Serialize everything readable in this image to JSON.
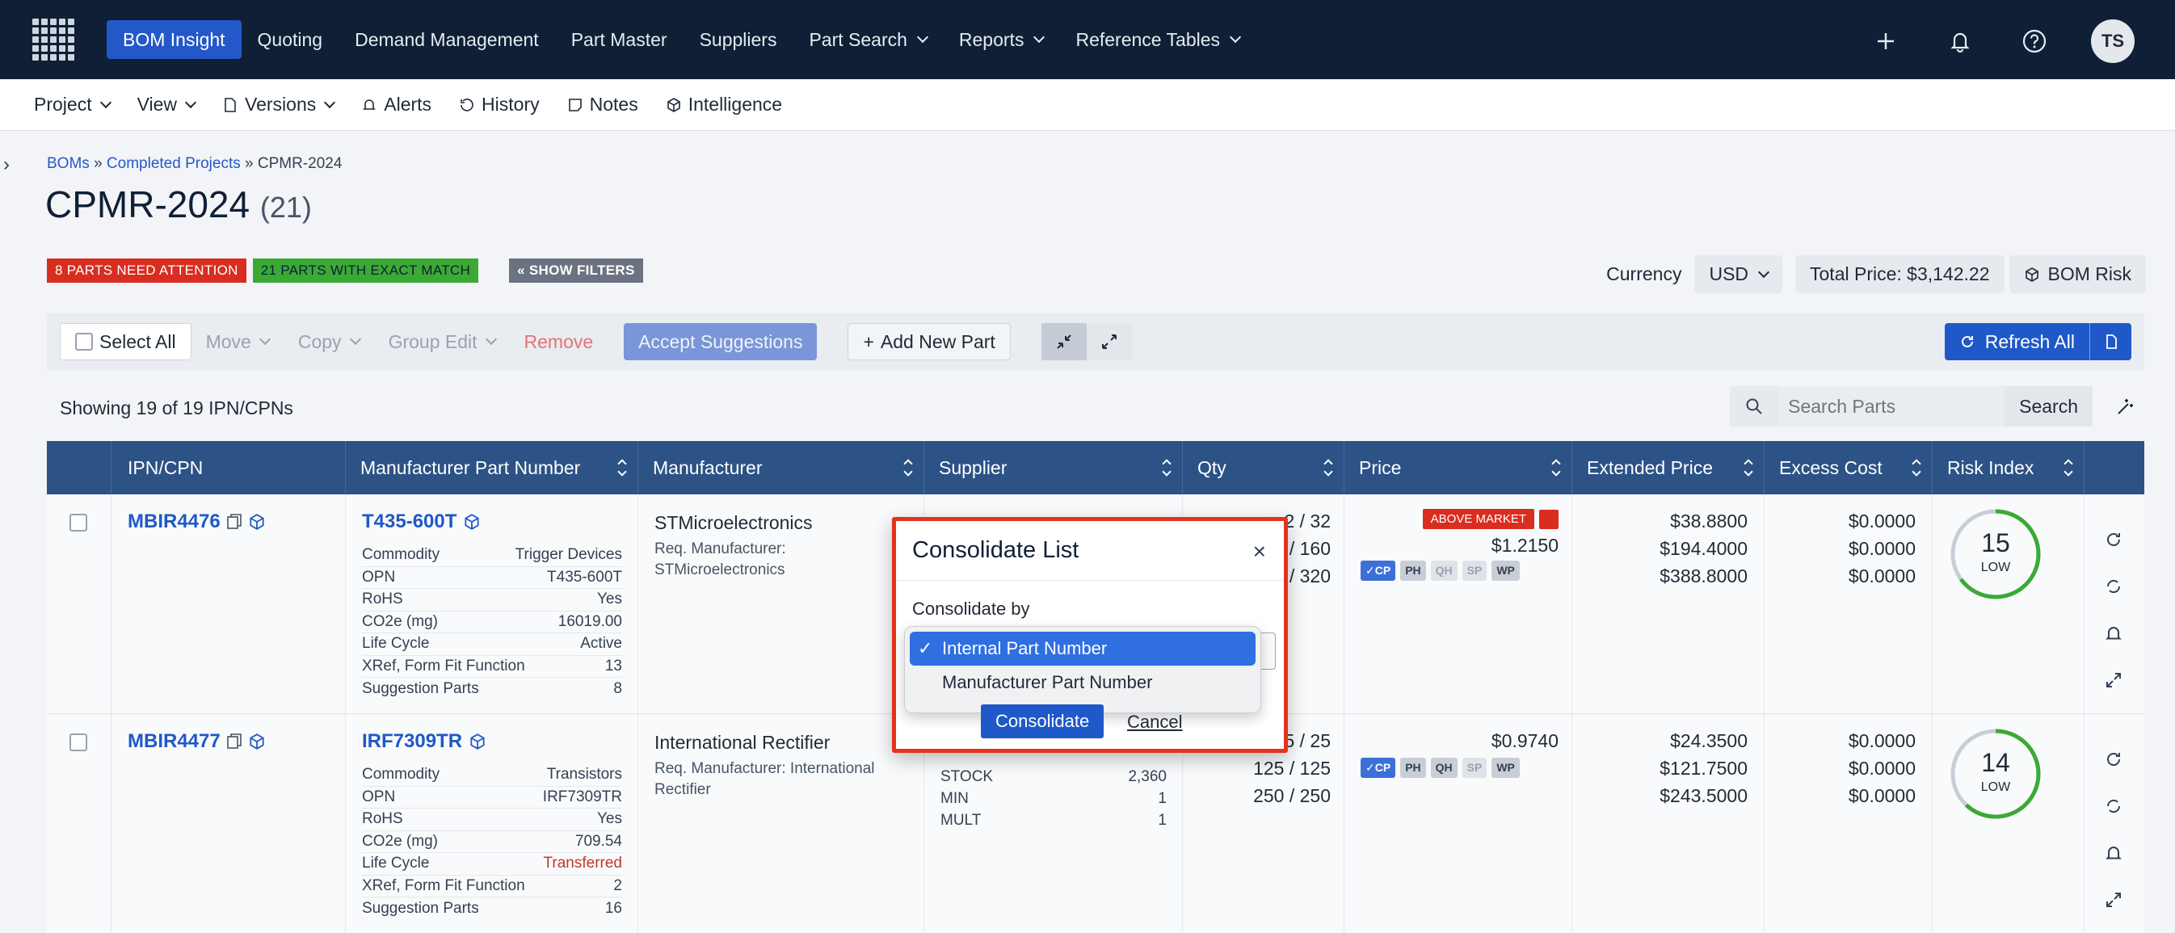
{
  "nav": {
    "items": [
      {
        "label": "BOM Insight",
        "active": true,
        "dropdown": false
      },
      {
        "label": "Quoting",
        "dropdown": false
      },
      {
        "label": "Demand Management",
        "dropdown": false
      },
      {
        "label": "Part Master",
        "dropdown": false
      },
      {
        "label": "Suppliers",
        "dropdown": false
      },
      {
        "label": "Part Search",
        "dropdown": true
      },
      {
        "label": "Reports",
        "dropdown": true
      },
      {
        "label": "Reference Tables",
        "dropdown": true
      }
    ],
    "avatar_initials": "TS"
  },
  "subbar": {
    "project": "Project",
    "view": "View",
    "versions": "Versions",
    "alerts": "Alerts",
    "history": "History",
    "notes": "Notes",
    "intelligence": "Intelligence"
  },
  "breadcrumb": {
    "root": "BOMs",
    "parent": "Completed Projects",
    "sep": "»",
    "current": "CPMR-2024"
  },
  "page": {
    "title": "CPMR-2024",
    "count": "(21)"
  },
  "badges": {
    "attention": "8 PARTS NEED ATTENTION",
    "exact": "21 PARTS WITH EXACT MATCH",
    "filters": "« SHOW FILTERS"
  },
  "currency": {
    "label": "Currency",
    "value": "USD",
    "total": "Total Price: $3,142.22",
    "risk": "BOM Risk"
  },
  "toolbar": {
    "select_all": "Select All",
    "move": "Move",
    "copy": "Copy",
    "group_edit": "Group Edit",
    "remove": "Remove",
    "accept": "Accept Suggestions",
    "add": "Add New Part",
    "refresh": "Refresh All"
  },
  "showing": "Showing 19 of 19 IPN/CPNs",
  "search": {
    "placeholder": "Search Parts",
    "button": "Search"
  },
  "columns": [
    "IPN/CPN",
    "Manufacturer Part Number",
    "Manufacturer",
    "Supplier",
    "Qty",
    "Price",
    "Extended Price",
    "Excess Cost",
    "Risk Index"
  ],
  "rows": [
    {
      "ipn": "MBIR4476",
      "mpn": "T435-600T",
      "commodity_label": "Commodity",
      "commodity": "Trigger Devices",
      "opn_label": "OPN",
      "opn": "T435-600T",
      "rohs_label": "RoHS",
      "rohs": "Yes",
      "co2_label": "CO2e (mg)",
      "co2": "16019.00",
      "lifecycle_label": "Life Cycle",
      "lifecycle": "Active",
      "xref_label": "XRef, Form Fit Function",
      "xref": "13",
      "sugg_label": "Suggestion Parts",
      "sugg": "8",
      "manufacturer": "STMicroelectronics",
      "req_mfr": "Req. Manufacturer: STMicroelectronics",
      "qty": [
        "2 / 32",
        "/ 160",
        "/ 320"
      ],
      "price_flag": "ABOVE MARKET",
      "price": "$1.2150",
      "chips": [
        "✓CP",
        "PH",
        "QH",
        "SP",
        "WP"
      ],
      "ext": [
        "$38.8800",
        "$194.4000",
        "$388.8000"
      ],
      "excess": [
        "$0.0000",
        "$0.0000",
        "$0.0000"
      ],
      "risk_value": 15,
      "risk_label": "LOW"
    },
    {
      "ipn": "MBIR4477",
      "mpn": "IRF7309TR",
      "commodity_label": "Commodity",
      "commodity": "Transistors",
      "opn_label": "OPN",
      "opn": "IRF7309TR",
      "rohs_label": "RoHS",
      "rohs": "Yes",
      "co2_label": "CO2e (mg)",
      "co2": "709.54",
      "lifecycle_label": "Life Cycle",
      "lifecycle": "Transferred",
      "xref_label": "XRef, Form Fit Function",
      "xref": "2",
      "sugg_label": "Suggestion Parts",
      "sugg": "16",
      "manufacturer": "International Rectifier",
      "req_mfr": "Req. Manufacturer: International Rectifier",
      "stock_label": "STOCK",
      "stock": "2,360",
      "min_label": "MIN",
      "min": "1",
      "mult_label": "MULT",
      "mult": "1",
      "qty": [
        "5 / 25",
        "125 / 125",
        "250 / 250"
      ],
      "price": "$0.9740",
      "chips": [
        "✓CP",
        "PH",
        "QH",
        "SP",
        "WP"
      ],
      "ext": [
        "$24.3500",
        "$121.7500",
        "$243.5000"
      ],
      "excess": [
        "$0.0000",
        "$0.0000",
        "$0.0000"
      ],
      "risk_value": 14,
      "risk_label": "LOW"
    }
  ],
  "modal": {
    "title": "Consolidate List",
    "label": "Consolidate by",
    "options": [
      "Internal Part Number",
      "Manufacturer Part Number"
    ],
    "selected": "Internal Part Number",
    "confirm": "Consolidate",
    "cancel": "Cancel"
  },
  "colors": {
    "nav_bg": "#0f1f35",
    "accent": "#1f58c8",
    "header_bg": "#2c5286",
    "alert_red": "#d92d20",
    "modal_border": "#e4321c"
  }
}
